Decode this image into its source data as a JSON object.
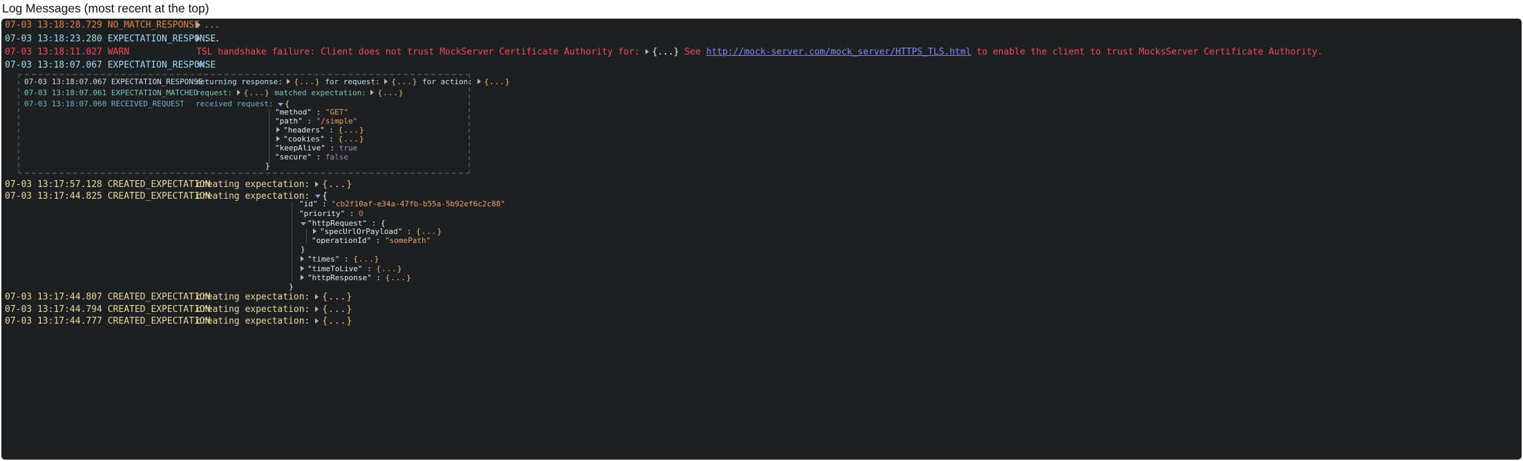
{
  "page_title": "Log Messages (most recent at the top)",
  "colors": {
    "background": "#1d1f21",
    "no_match": "#e3843d",
    "expectation": "#9edcf8",
    "warn": "#ef4d59",
    "created": "#ebd99e"
  },
  "entries": [
    {
      "time": "07-03 13:18:28.729",
      "type": "NO_MATCH_RESPONSE",
      "collapsed": "..."
    },
    {
      "time": "07-03 13:18:23.280",
      "type": "EXPECTATION_RESPONSE",
      "collapsed": "..."
    },
    {
      "time": "07-03 13:18:11.027",
      "type": "WARN",
      "message_pre": "TSL handshake failure: Client does not trust MockServer Certificate Authority for:",
      "message_see": "See",
      "link": "http://mock-server.com/mock_server/HTTPS_TLS.html",
      "message_post": "to enable the client to trust MocksServer Certificate Authority."
    },
    {
      "time": "07-03 13:18:07.067",
      "type": "EXPECTATION_RESPONSE"
    }
  ],
  "group": [
    {
      "time": "07-03 13:18:07.067",
      "type": "EXPECTATION_RESPONSE",
      "p1": "returning response:",
      "p2": "for request:",
      "p3": "for action:"
    },
    {
      "time": "07-03 13:18:07.061",
      "type": "EXPECTATION_MATCHED",
      "p1": "request:",
      "p2": "matched expectation:"
    },
    {
      "time": "07-03 13:18:07.060",
      "type": "RECEIVED_REQUEST",
      "p1": "received request:"
    }
  ],
  "request_json": {
    "method_key": "\"method\"",
    "method_val": "\"GET\"",
    "path_key": "\"path\"",
    "path_val": "\"/simple\"",
    "headers_key": "\"headers\"",
    "cookies_key": "\"cookies\"",
    "keepalive_key": "\"keepAlive\"",
    "keepalive_val": "true",
    "secure_key": "\"secure\"",
    "secure_val": "false"
  },
  "created": [
    {
      "time": "07-03 13:17:57.128",
      "type": "CREATED_EXPECTATION",
      "label": "creating expectation:"
    },
    {
      "time": "07-03 13:17:44.825",
      "type": "CREATED_EXPECTATION",
      "label": "creating expectation:"
    },
    {
      "time": "07-03 13:17:44.807",
      "type": "CREATED_EXPECTATION",
      "label": "creating expectation:"
    },
    {
      "time": "07-03 13:17:44.794",
      "type": "CREATED_EXPECTATION",
      "label": "creating expectation:"
    },
    {
      "time": "07-03 13:17:44.777",
      "type": "CREATED_EXPECTATION",
      "label": "creating expectation:"
    }
  ],
  "expectation_json": {
    "id_key": "\"id\"",
    "id_val": "\"cb2f10af-e34a-47fb-b55a-5b92ef6c2c88\"",
    "priority_key": "\"priority\"",
    "priority_val": "0",
    "httprequest_key": "\"httpRequest\"",
    "spec_key": "\"specUrlOrPayload\"",
    "opid_key": "\"operationId\"",
    "opid_val": "\"somePath\"",
    "times_key": "\"times\"",
    "ttl_key": "\"timeToLive\"",
    "httpresponse_key": "\"httpResponse\""
  },
  "symbols": {
    "obj_collapsed": "{...}",
    "colon": ":",
    "open_brace": "{",
    "close_brace": "}",
    "dots": "..."
  }
}
